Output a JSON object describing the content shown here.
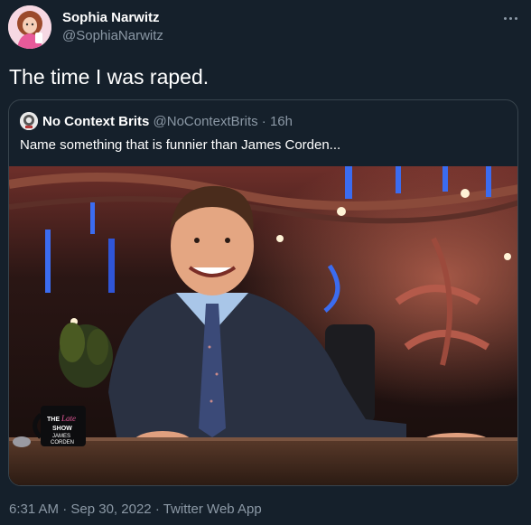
{
  "author": {
    "display_name": "Sophia Narwitz",
    "handle": "@SophiaNarwitz"
  },
  "tweet_text": "The time I was raped.",
  "quoted_tweet": {
    "display_name": "No Context Brits",
    "handle": "@NoContextBrits",
    "separator": "·",
    "time": "16h",
    "text": "Name something that is funnier than James Corden...",
    "mug_text": {
      "line1": "THE",
      "line2": "Late",
      "line3": "SHOW",
      "line4": "JAMES",
      "line5": "CORDEN"
    }
  },
  "footer": {
    "time": "6:31 AM",
    "date": "Sep 30, 2022",
    "separator": "·",
    "source": "Twitter Web App"
  },
  "icons": {
    "more": "more-horizontal-icon"
  },
  "colors": {
    "background": "#15202b",
    "text": "#ffffff",
    "secondary": "#8b98a5",
    "border": "#38444d"
  }
}
